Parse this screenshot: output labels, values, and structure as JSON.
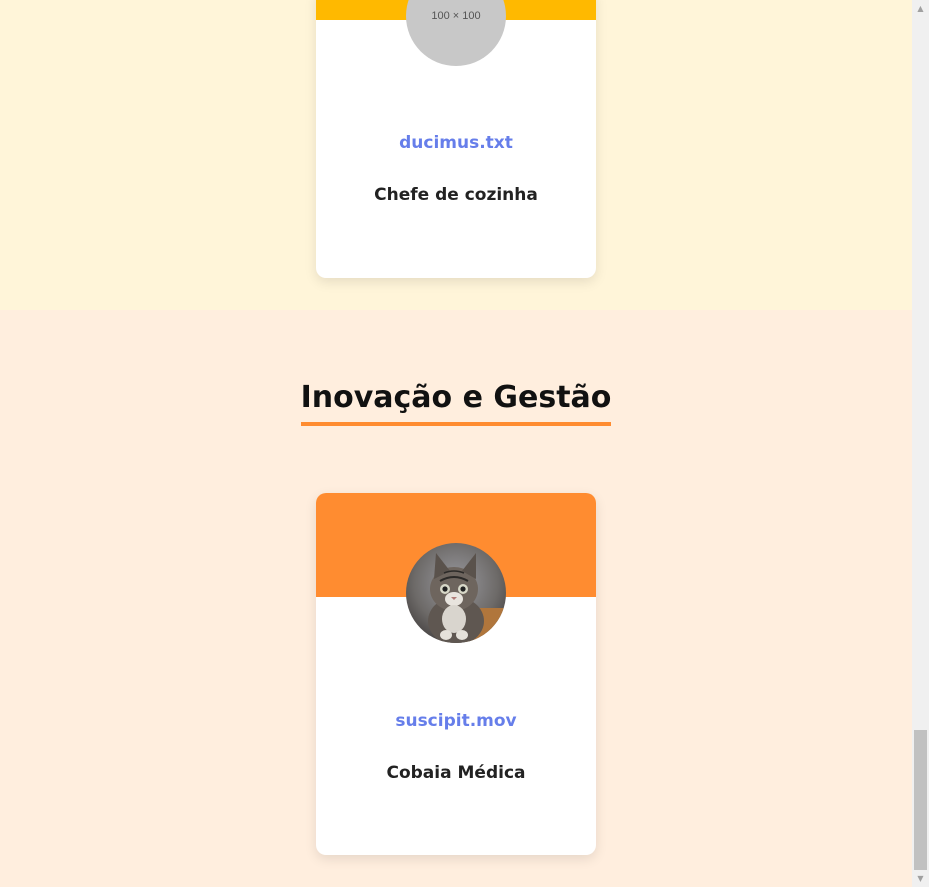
{
  "cards": [
    {
      "avatar_placeholder": "100 × 100",
      "name": "ducimus.txt",
      "role": "Chefe de cozinha"
    },
    {
      "avatar_icon": "kitten-photo",
      "name": "suscipit.mov",
      "role": "Cobaia Médica"
    }
  ],
  "section": {
    "title": "Inovação e Gestão"
  },
  "colors": {
    "top_bg": "#fff5d9",
    "bottom_bg": "#ffeede",
    "card_header_yellow": "#ffb900",
    "card_header_orange": "#ff8c30",
    "name_color": "#667eea",
    "underline": "#ff8c30"
  },
  "scrollbar": {
    "up_icon": "▲",
    "down_icon": "▼"
  }
}
